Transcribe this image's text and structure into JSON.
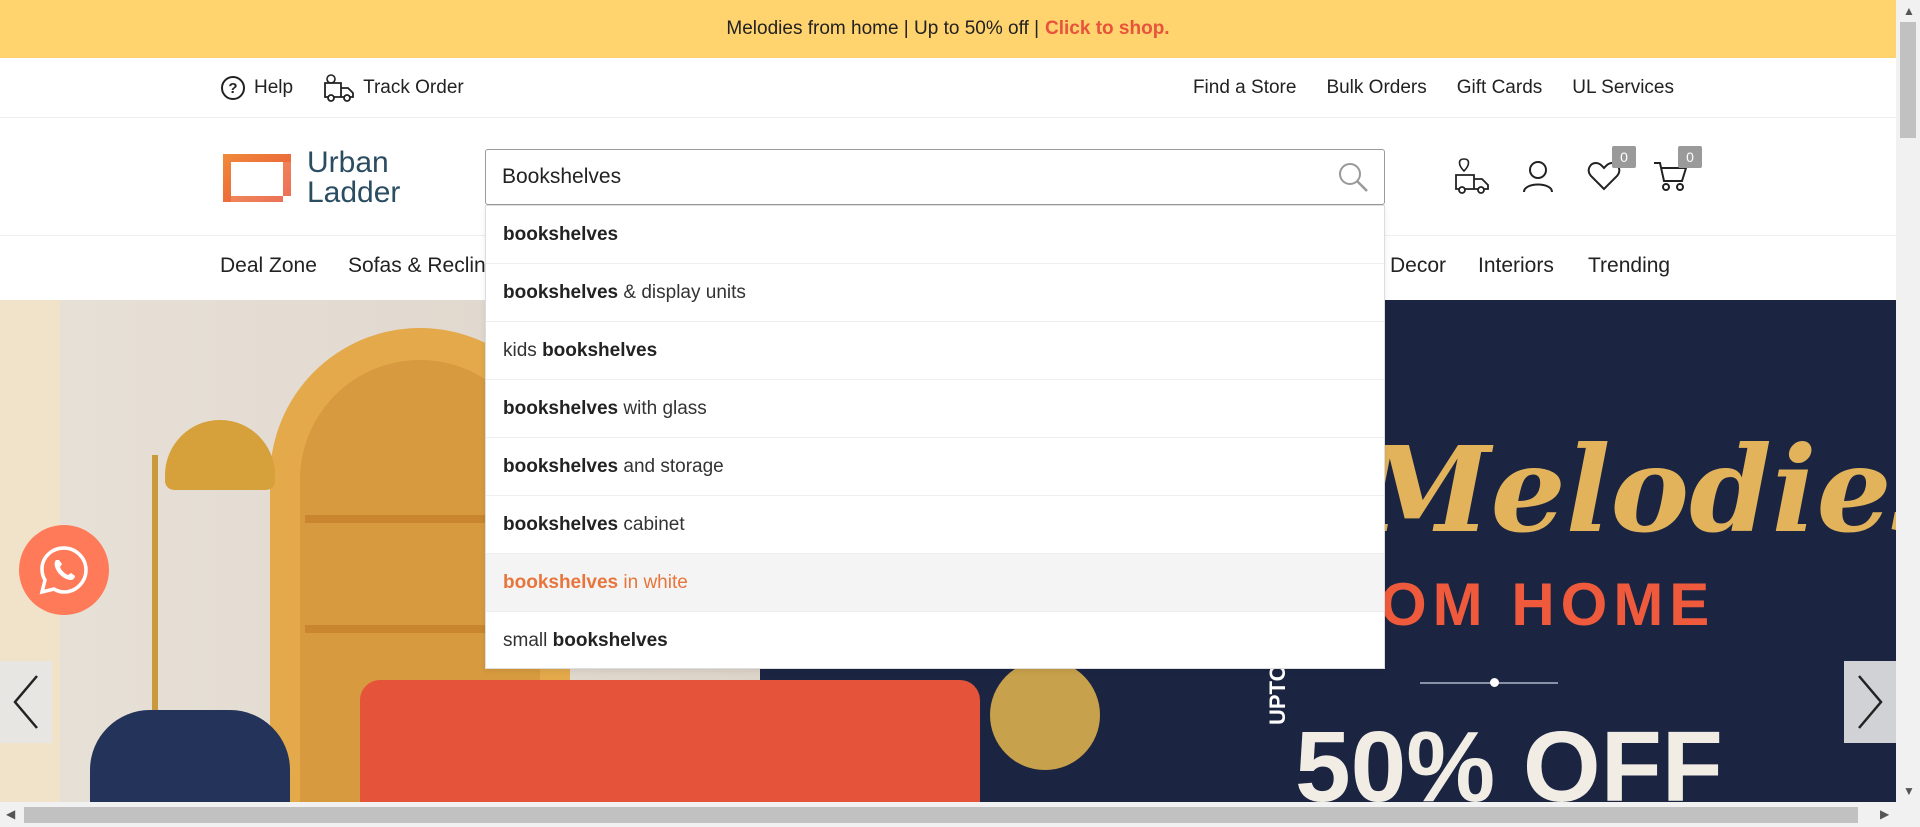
{
  "promo": {
    "text": "Melodies from home | Up to 50% off |",
    "cta": "Click to shop."
  },
  "util": {
    "left": [
      {
        "label": "Help",
        "icon": "help-icon"
      },
      {
        "label": "Track Order",
        "icon": "truck-icon"
      }
    ],
    "right": [
      "Find a Store",
      "Bulk Orders",
      "Gift Cards",
      "UL Services"
    ]
  },
  "logo": {
    "line1": "Urban",
    "line2": "Ladder"
  },
  "search": {
    "value": "Bookshelves",
    "placeholder": ""
  },
  "header_icons": {
    "wishlist_count": "0",
    "cart_count": "0"
  },
  "nav": [
    "Deal Zone",
    "Sofas & Reclin",
    "Decor",
    "Interiors",
    "Trending"
  ],
  "suggestions": [
    {
      "pre": "",
      "bold": "bookshelves",
      "post": ""
    },
    {
      "pre": "",
      "bold": "bookshelves",
      "post": " & display units"
    },
    {
      "pre": "kids ",
      "bold": "bookshelves",
      "post": ""
    },
    {
      "pre": "",
      "bold": "bookshelves",
      "post": " with glass"
    },
    {
      "pre": "",
      "bold": "bookshelves",
      "post": " and storage"
    },
    {
      "pre": "",
      "bold": "bookshelves",
      "post": " cabinet"
    },
    {
      "pre": "",
      "bold": "bookshelves",
      "post": " in white"
    },
    {
      "pre": "small ",
      "bold": "bookshelves",
      "post": ""
    }
  ],
  "hero": {
    "title": "Melodies",
    "subtitle": "OM HOME",
    "upto": "UPTO",
    "offer": "50% OFF"
  },
  "colors": {
    "promo_bg": "#ffd36e",
    "accent": "#e8533b",
    "brand": "#2a4d62"
  }
}
